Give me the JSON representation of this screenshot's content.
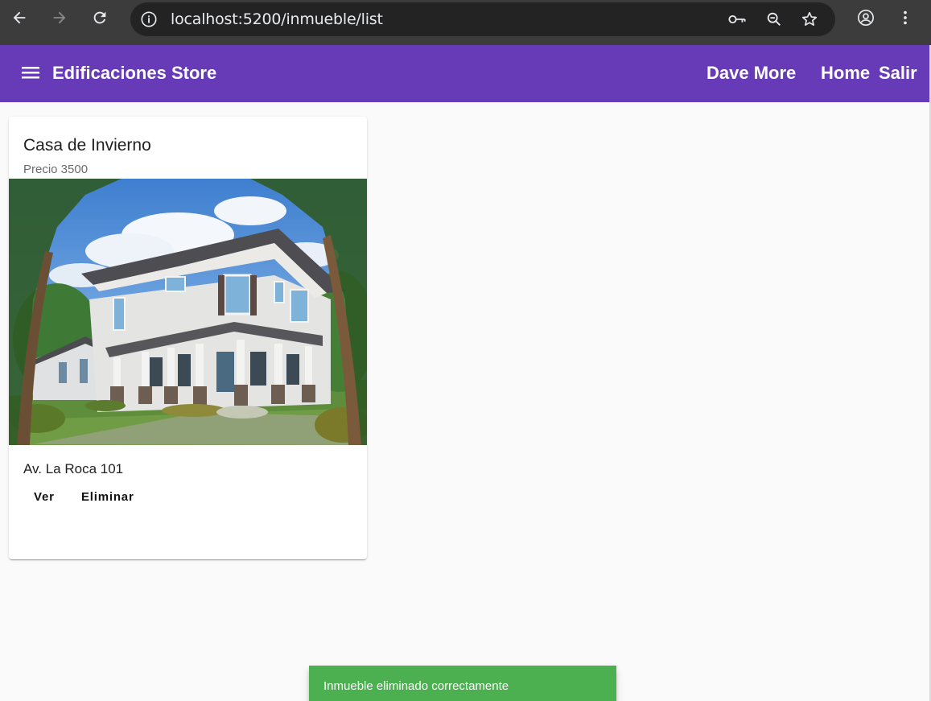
{
  "browser": {
    "url": "localhost:5200/inmueble/list"
  },
  "toolbar": {
    "title": "Edificaciones Store",
    "user_name": "Dave More",
    "home_label": "Home",
    "logout_label": "Salir",
    "color": "#673ab7"
  },
  "card": {
    "title": "Casa de Invierno",
    "subtitle": "Precio 3500",
    "address": "Av. La Roca 101",
    "view_label": "Ver",
    "delete_label": "Eliminar"
  },
  "snackbar": {
    "message": "Inmueble eliminado correctamente",
    "color": "#4caf50"
  },
  "icons": [
    "arrow-left-icon",
    "arrow-right-icon",
    "reload-icon",
    "info-icon",
    "key-icon",
    "zoom-icon",
    "star-icon",
    "account-icon",
    "more-vert-icon",
    "menu-icon"
  ]
}
